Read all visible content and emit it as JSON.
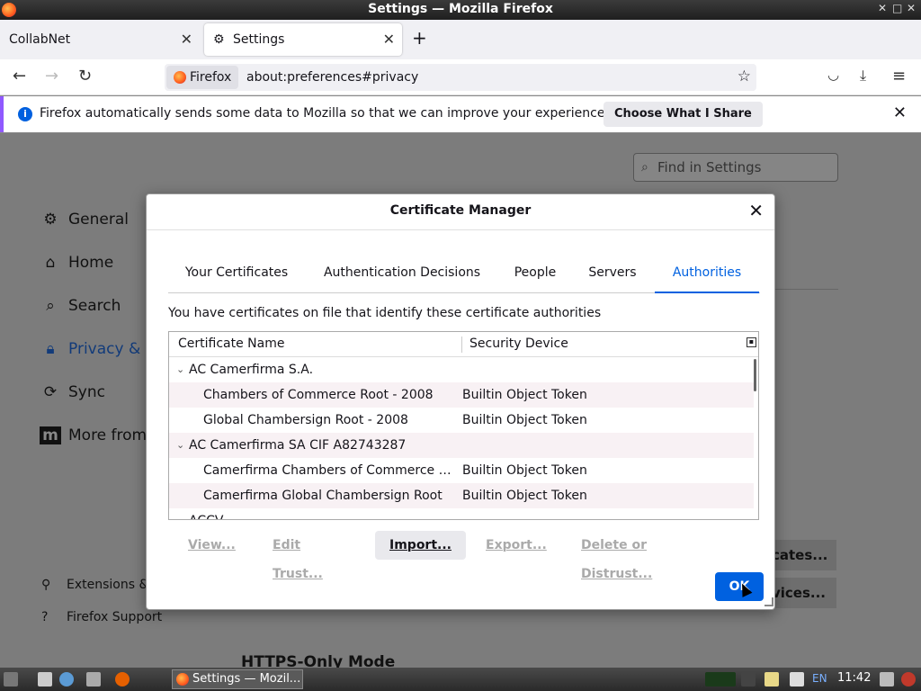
{
  "window": {
    "title": "Settings — Mozilla Firefox"
  },
  "tabs": [
    {
      "label": "CollabNet"
    },
    {
      "label": "Settings"
    }
  ],
  "navbar": {
    "identity_label": "Firefox",
    "url": "about:preferences#privacy"
  },
  "notification": {
    "message": "Firefox automatically sends some data to Mozilla so that we can improve your experience.",
    "button": "Choose What I Share"
  },
  "page": {
    "find_placeholder": "Find in Settings",
    "nav": [
      {
        "label": "General"
      },
      {
        "label": "Home"
      },
      {
        "label": "Search"
      },
      {
        "label": "Privacy & S"
      },
      {
        "label": "Sync"
      },
      {
        "label": "More from"
      }
    ],
    "extensions_label": "Extensions &",
    "support_label": "Firefox Support",
    "bg_button_1": "cates...",
    "bg_button_2": "vices...",
    "https_heading": "HTTPS-Only Mode"
  },
  "dialog": {
    "title": "Certificate Manager",
    "tabs": [
      "Your Certificates",
      "Authentication Decisions",
      "People",
      "Servers",
      "Authorities"
    ],
    "active_tab": "Authorities",
    "description": "You have certificates on file that identify these certificate authorities",
    "columns": [
      "Certificate Name",
      "Security Device"
    ],
    "rows": [
      {
        "name": "AC Camerfirma S.A.",
        "device": "",
        "group": true
      },
      {
        "name": "Chambers of Commerce Root - 2008",
        "device": "Builtin Object Token",
        "group": false
      },
      {
        "name": "Global Chambersign Root - 2008",
        "device": "Builtin Object Token",
        "group": false
      },
      {
        "name": "AC Camerfirma SA CIF A82743287",
        "device": "",
        "group": true
      },
      {
        "name": "Camerfirma Chambers of Commerce Root",
        "device": "Builtin Object Token",
        "group": false
      },
      {
        "name": "Camerfirma Global Chambersign Root",
        "device": "Builtin Object Token",
        "group": false
      },
      {
        "name": "ACCV",
        "device": "",
        "group": true
      }
    ],
    "buttons": {
      "view": "View...",
      "edit_trust": "Edit Trust...",
      "import": "Import...",
      "export": "Export...",
      "delete": "Delete or Distrust..."
    },
    "ok": "OK"
  },
  "taskbar": {
    "window_label": "Settings — Mozil...",
    "lang": "EN",
    "clock": "11:42"
  },
  "colors": {
    "accent": "#0061e0",
    "notification_border": "#9059ff"
  }
}
